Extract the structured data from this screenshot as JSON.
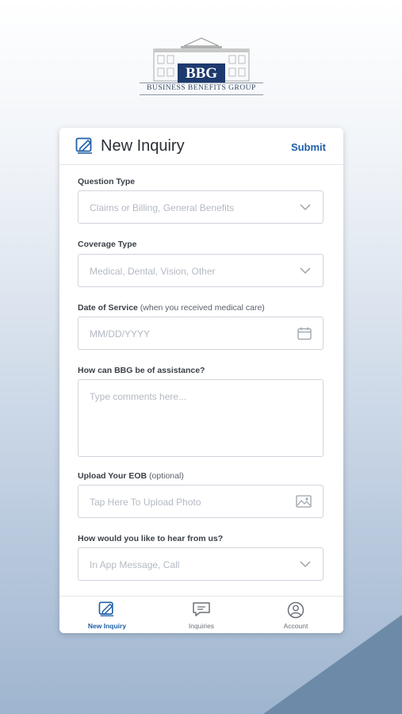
{
  "logo": {
    "mark": "BBG",
    "subtitle": "BUSINESS BENEFITS GROUP"
  },
  "header": {
    "title": "New Inquiry",
    "submit_label": "Submit"
  },
  "form": {
    "question_type": {
      "label": "Question Type",
      "placeholder": "Claims or Billing, General Benefits",
      "icon": "chevron-down-icon"
    },
    "coverage_type": {
      "label": "Coverage Type",
      "placeholder": "Medical, Dental, Vision, Other",
      "icon": "chevron-down-icon"
    },
    "date_of_service": {
      "label": "Date of Service",
      "label_note": "(when you received medical care)",
      "placeholder": "MM/DD/YYYY",
      "icon": "calendar-icon"
    },
    "assistance": {
      "label": "How can BBG be of assistance?",
      "placeholder": "Type comments here..."
    },
    "upload_eob": {
      "label": "Upload Your EOB",
      "label_note": "(optional)",
      "placeholder": "Tap Here To Upload Photo",
      "icon": "image-icon"
    },
    "contact_method": {
      "label": "How would you like to hear from us?",
      "placeholder": "In App Message, Call",
      "icon": "chevron-down-icon"
    }
  },
  "tabs": [
    {
      "label": "New Inquiry",
      "icon": "edit-icon",
      "active": true
    },
    {
      "label": "Inquiries",
      "icon": "chat-icon",
      "active": false
    },
    {
      "label": "Account",
      "icon": "user-icon",
      "active": false
    }
  ],
  "colors": {
    "accent": "#1f5fa8",
    "logo_blue": "#1d3a6e",
    "corner": "#6d8aa8"
  }
}
